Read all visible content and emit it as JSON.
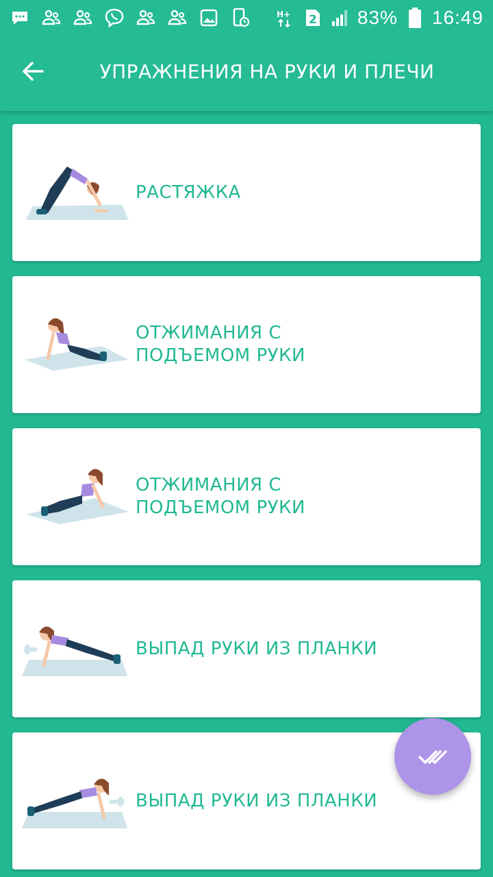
{
  "status_bar": {
    "network_type": "H+",
    "sim_slot": "2",
    "battery": "83%",
    "time": "16:49",
    "icons": [
      "message-icon",
      "contacts-icon",
      "contacts-icon",
      "viber-icon",
      "contacts-icon",
      "contacts-icon",
      "image-icon",
      "phone-timer-icon",
      "network-icon",
      "sim-icon",
      "signal-icon",
      "battery-icon"
    ]
  },
  "app_bar": {
    "title": "УПРАЖНЕНИЯ НА РУКИ И ПЛЕЧИ",
    "back_icon": "arrow-back-icon"
  },
  "exercises": [
    {
      "label": "РАСТЯЖКА",
      "pose": "downward-dog"
    },
    {
      "label": "ОТЖИМАНИЯ С ПОДЪЕМОМ РУКИ",
      "pose": "pushup-left"
    },
    {
      "label": "ОТЖИМАНИЯ С ПОДЪЕМОМ РУКИ",
      "pose": "pushup-right"
    },
    {
      "label": "ВЫПАД РУКИ ИЗ ПЛАНКИ",
      "pose": "plank-reach-left"
    },
    {
      "label": "ВЫПАД РУКИ ИЗ ПЛАНКИ",
      "pose": "plank-reach-right"
    }
  ],
  "fab": {
    "icon": "done-all-icon"
  },
  "colors": {
    "primary": "#25bb95",
    "background": "#22b892",
    "accent_text": "#22b892",
    "fab": "#ad94e8",
    "mat": "#cfe4ea",
    "top": "#a78be0",
    "pants": "#1f3d57",
    "hair": "#8a4a2e",
    "skin": "#f6c9a8",
    "shoes": "#25bb95"
  }
}
